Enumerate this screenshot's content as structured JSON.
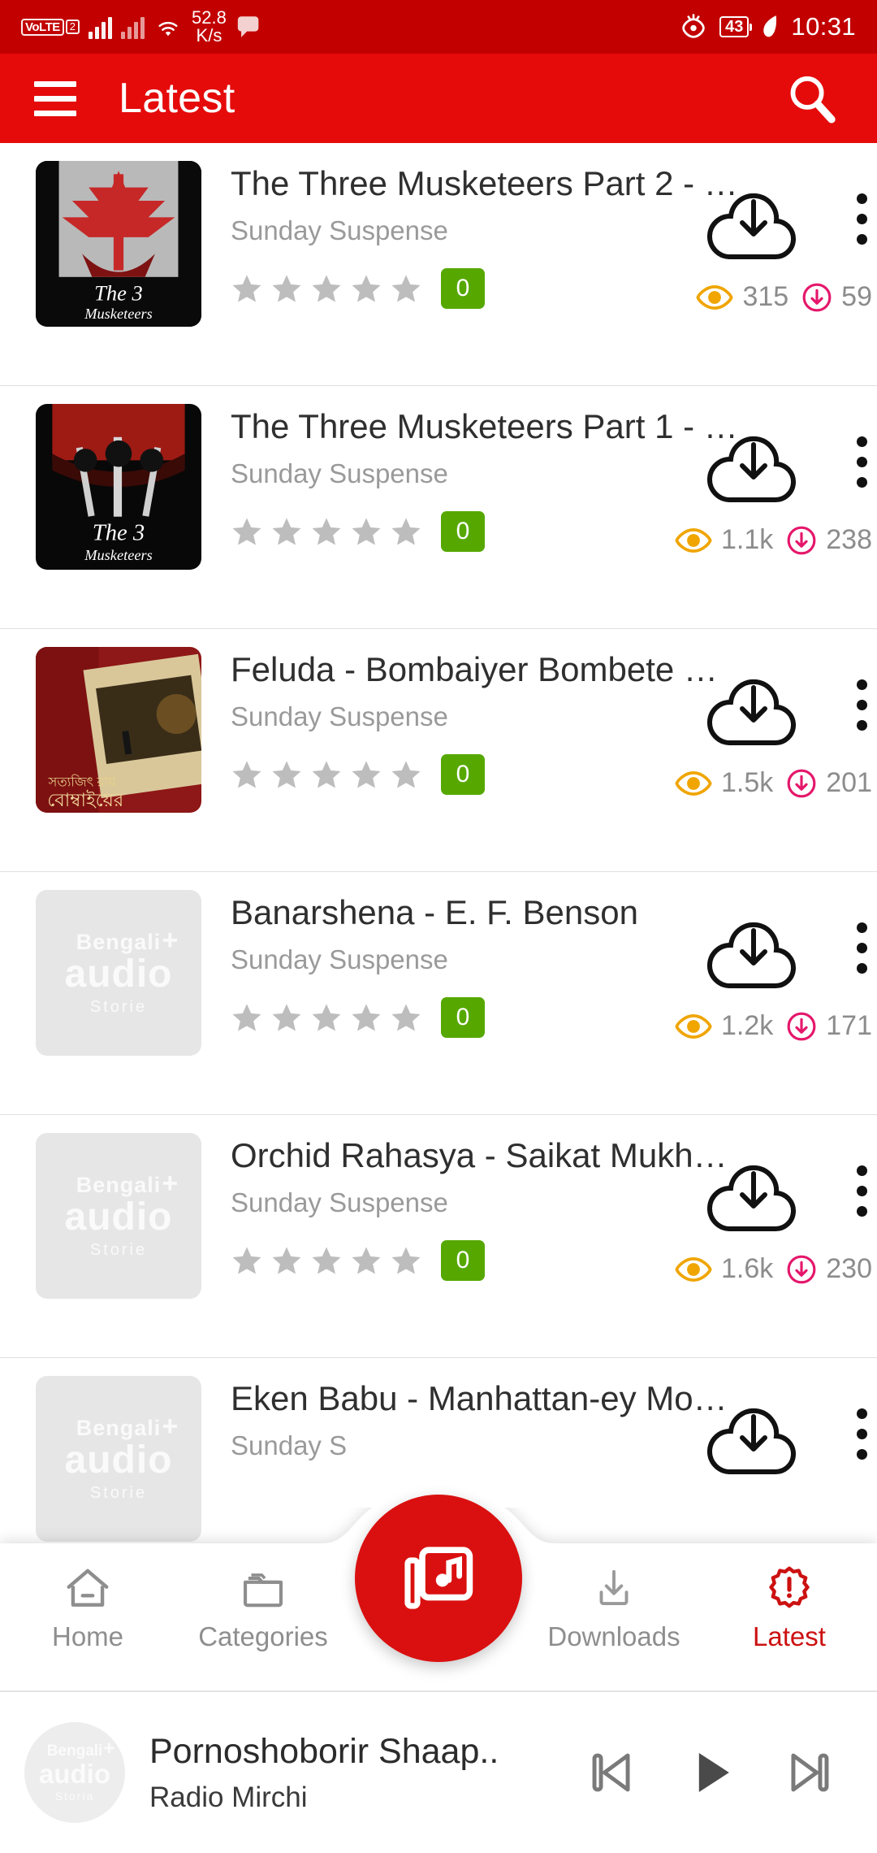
{
  "status_bar": {
    "volte_label": "VoLTE",
    "sim_number": "2",
    "network_speed_value": "52.8",
    "network_speed_unit": "K/s",
    "battery_level": "43",
    "time": "10:31",
    "icons": [
      "volte-icon",
      "signal-bars-icon",
      "signal-bars-secondary-icon",
      "wifi-icon",
      "message-bubble-icon",
      "eye-care-icon",
      "battery-icon",
      "leaf-power-saving-icon"
    ],
    "background_color": "#C20000"
  },
  "app_bar": {
    "title": "Latest",
    "menu_icon": "hamburger-menu-icon",
    "search_icon": "search-icon",
    "background_color": "#E50B0B"
  },
  "list": {
    "items": [
      {
        "title": "The Three Musketeers Part 2 - …",
        "subtitle": "Sunday Suspense",
        "rating": 0,
        "rating_badge": "0",
        "views": "315",
        "downloads": "59",
        "thumb_type": "artwork-musketeers-grey",
        "download_icon": "cloud-download-icon",
        "overflow_icon": "more-vertical-icon"
      },
      {
        "title": "The Three Musketeers Part 1 - …",
        "subtitle": "Sunday Suspense",
        "rating": 0,
        "rating_badge": "0",
        "views": "1.1k",
        "downloads": "238",
        "thumb_type": "artwork-musketeers-dark",
        "download_icon": "cloud-download-icon",
        "overflow_icon": "more-vertical-icon"
      },
      {
        "title": "Feluda - Bombaiyer Bombete …",
        "subtitle": "Sunday Suspense",
        "rating": 0,
        "rating_badge": "0",
        "views": "1.5k",
        "downloads": "201",
        "thumb_type": "artwork-feluda",
        "download_icon": "cloud-download-icon",
        "overflow_icon": "more-vertical-icon"
      },
      {
        "title": "Banarshena - E. F. Benson",
        "subtitle": "Sunday Suspense",
        "rating": 0,
        "rating_badge": "0",
        "views": "1.2k",
        "downloads": "171",
        "thumb_type": "placeholder",
        "download_icon": "cloud-download-icon",
        "overflow_icon": "more-vertical-icon"
      },
      {
        "title": "Orchid Rahasya - Saikat Mukh…",
        "subtitle": "Sunday Suspense",
        "rating": 0,
        "rating_badge": "0",
        "views": "1.6k",
        "downloads": "230",
        "thumb_type": "placeholder",
        "download_icon": "cloud-download-icon",
        "overflow_icon": "more-vertical-icon"
      },
      {
        "title": "Eken Babu - Manhattan-ey Mo…",
        "subtitle": "Sunday S",
        "rating": 0,
        "rating_badge": "0",
        "views": "",
        "downloads": "",
        "thumb_type": "placeholder",
        "download_icon": "cloud-download-icon",
        "overflow_icon": "more-vertical-icon"
      }
    ],
    "placeholder_watermark": {
      "line1": "Bengali",
      "plus": "+",
      "line2": "audio",
      "line3": "Storie"
    },
    "colors": {
      "title": "#2f2f2f",
      "subtitle": "#9a9a9a",
      "star_empty": "#BDBDBD",
      "rating_badge_bg": "#56A800",
      "views_icon": "#F0A500",
      "downloads_icon": "#E5176B",
      "metric_text": "#8c8c8c"
    }
  },
  "bottom_nav": {
    "items": [
      {
        "label": "Home",
        "icon": "home-icon",
        "active": false
      },
      {
        "label": "Categories",
        "icon": "folder-icon",
        "active": false
      },
      {
        "label": "Downloads",
        "icon": "download-tray-icon",
        "active": false
      },
      {
        "label": "Latest",
        "icon": "badge-exclamation-icon",
        "active": true
      }
    ],
    "fab": {
      "icon": "music-library-icon",
      "color": "#DA1010"
    },
    "active_color": "#CC1111",
    "inactive_color": "#8e8e8e"
  },
  "mini_player": {
    "title": "Pornoshoborir Shaap..",
    "subtitle": "Radio Mirchi",
    "avatar_watermark": {
      "line1": "Bengali",
      "plus": "+",
      "line2": "audio",
      "line3": "Storia"
    },
    "controls": [
      {
        "name": "previous-track-button",
        "icon": "skip-previous-icon"
      },
      {
        "name": "play-button",
        "icon": "play-icon"
      },
      {
        "name": "next-track-button",
        "icon": "skip-next-icon"
      }
    ]
  }
}
